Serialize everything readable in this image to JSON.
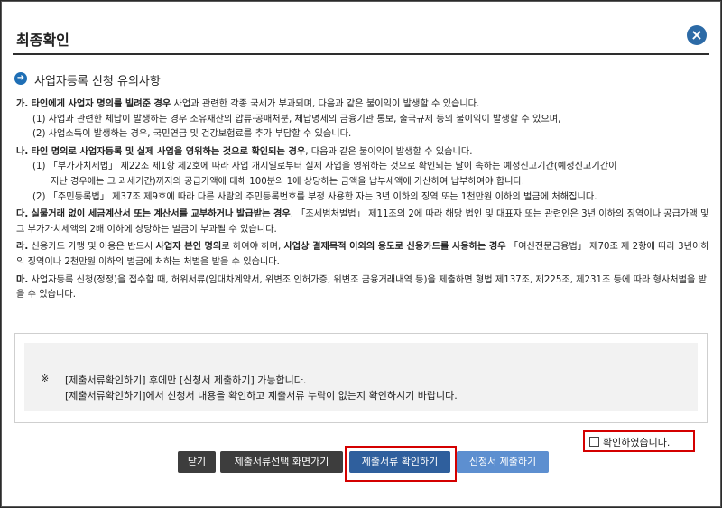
{
  "dialog": {
    "title": "최종확인"
  },
  "section": {
    "title": "사업자등록 신청 유의사항"
  },
  "notices": [
    {
      "prefix": "가.",
      "lead": "타인에게 사업자 명의를 빌려준 경우",
      "text": " 사업과 관련한 각종 국세가 부과되며, 다음과 같은 불이익이 발생할 수 있습니다.",
      "subs": [
        "(1) 사업과 관련한 체납이 발생하는 경우 소유재산의 압류·공매처분, 체납명세의 금융기관 통보, 출국규제 등의 불이익이 발생할 수 있으며,",
        "(2) 사업소득이 발생하는 경우, 국민연금 및 건강보험료를 추가 부담할 수 있습니다."
      ]
    },
    {
      "prefix": "나.",
      "lead": "타인 명의로 사업자등록 및 실제 사업을 영위하는 것으로 확인되는 경우",
      "text": ", 다음과 같은 불이익이 발생할 수 있습니다.",
      "subs": [
        "(1) 「부가가치세법」 제22조 제1항 제2호에 따라 사업 개시일로부터 실제 사업을 영위하는 것으로 확인되는 날이 속하는 예정신고기간(예정신고기간이",
        "지난 경우에는 그 과세기간)까지의 공급가액에 대해 100분의 1에 상당하는 금액을 납부세액에 가산하여 납부하여야 합니다.",
        "(2) 「주민등록법」 제37조 제9호에 따라 다른 사람의 주민등록번호를 부정 사용한 자는 3년 이하의 징역 또는 1천만원 이하의 벌금에 처해집니다."
      ]
    },
    {
      "prefix": "다.",
      "lead": "실물거래 없이 세금계산서 또는 계산서를 교부하거나 발급받는 경우",
      "text": ", 「조세범처벌법」 제11조의 2에 따라 해당 법인 및 대표자 또는 관련인은 3년 이하의 징역이나 공급가액 및 그 부가가치세액의 2배 이하에 상당하는 벌금이 부과될 수 있습니다."
    },
    {
      "prefix": "라.",
      "pre": " 신용카드 가맹 및 이용은 반드시 ",
      "lead": "사업자 본인 명의",
      "mid": "로 하여야 하며, ",
      "lead2": "사업상 결제목적 이외의 용도로 신용카드를 사용하는 경우",
      "text": " 「여신전문금융법」 제70조 제 2항에 따라 3년이하의 징역이나 2천만원 이하의 벌금에 처하는 처벌을 받을 수 있습니다."
    },
    {
      "prefix": "마.",
      "text": " 사업자등록 신청(정정)을 접수할 때, 허위서류(임대차계약서, 위변조 인허가증, 위변조 금융거래내역 등)을 제출하면 형법 제137조, 제225조, 제231조 등에 따라 형사처벌을 받을 수 있습니다."
    }
  ],
  "info": {
    "mark": "※",
    "line1": "[제출서류확인하기] 후에만 [신청서 제출하기] 가능합니다.",
    "line2": "[제출서류확인하기]에서 신청서 내용을 확인하고 제출서류 누락이 없는지 확인하시기 바랍니다."
  },
  "confirm": {
    "label": "확인하였습니다.",
    "checked": false
  },
  "buttons": {
    "close": "닫기",
    "select_docs": "제출서류선택 화면가기",
    "verify_docs": "제출서류 확인하기",
    "submit": "신청서 제출하기"
  },
  "icons": {
    "close": "close-icon",
    "section": "arrow-right-circle-icon"
  },
  "colors": {
    "accent": "#2c6aa6",
    "highlight": "#d40000",
    "dark_button": "#3d3d3d",
    "submit_button": "#5d8fd0"
  }
}
